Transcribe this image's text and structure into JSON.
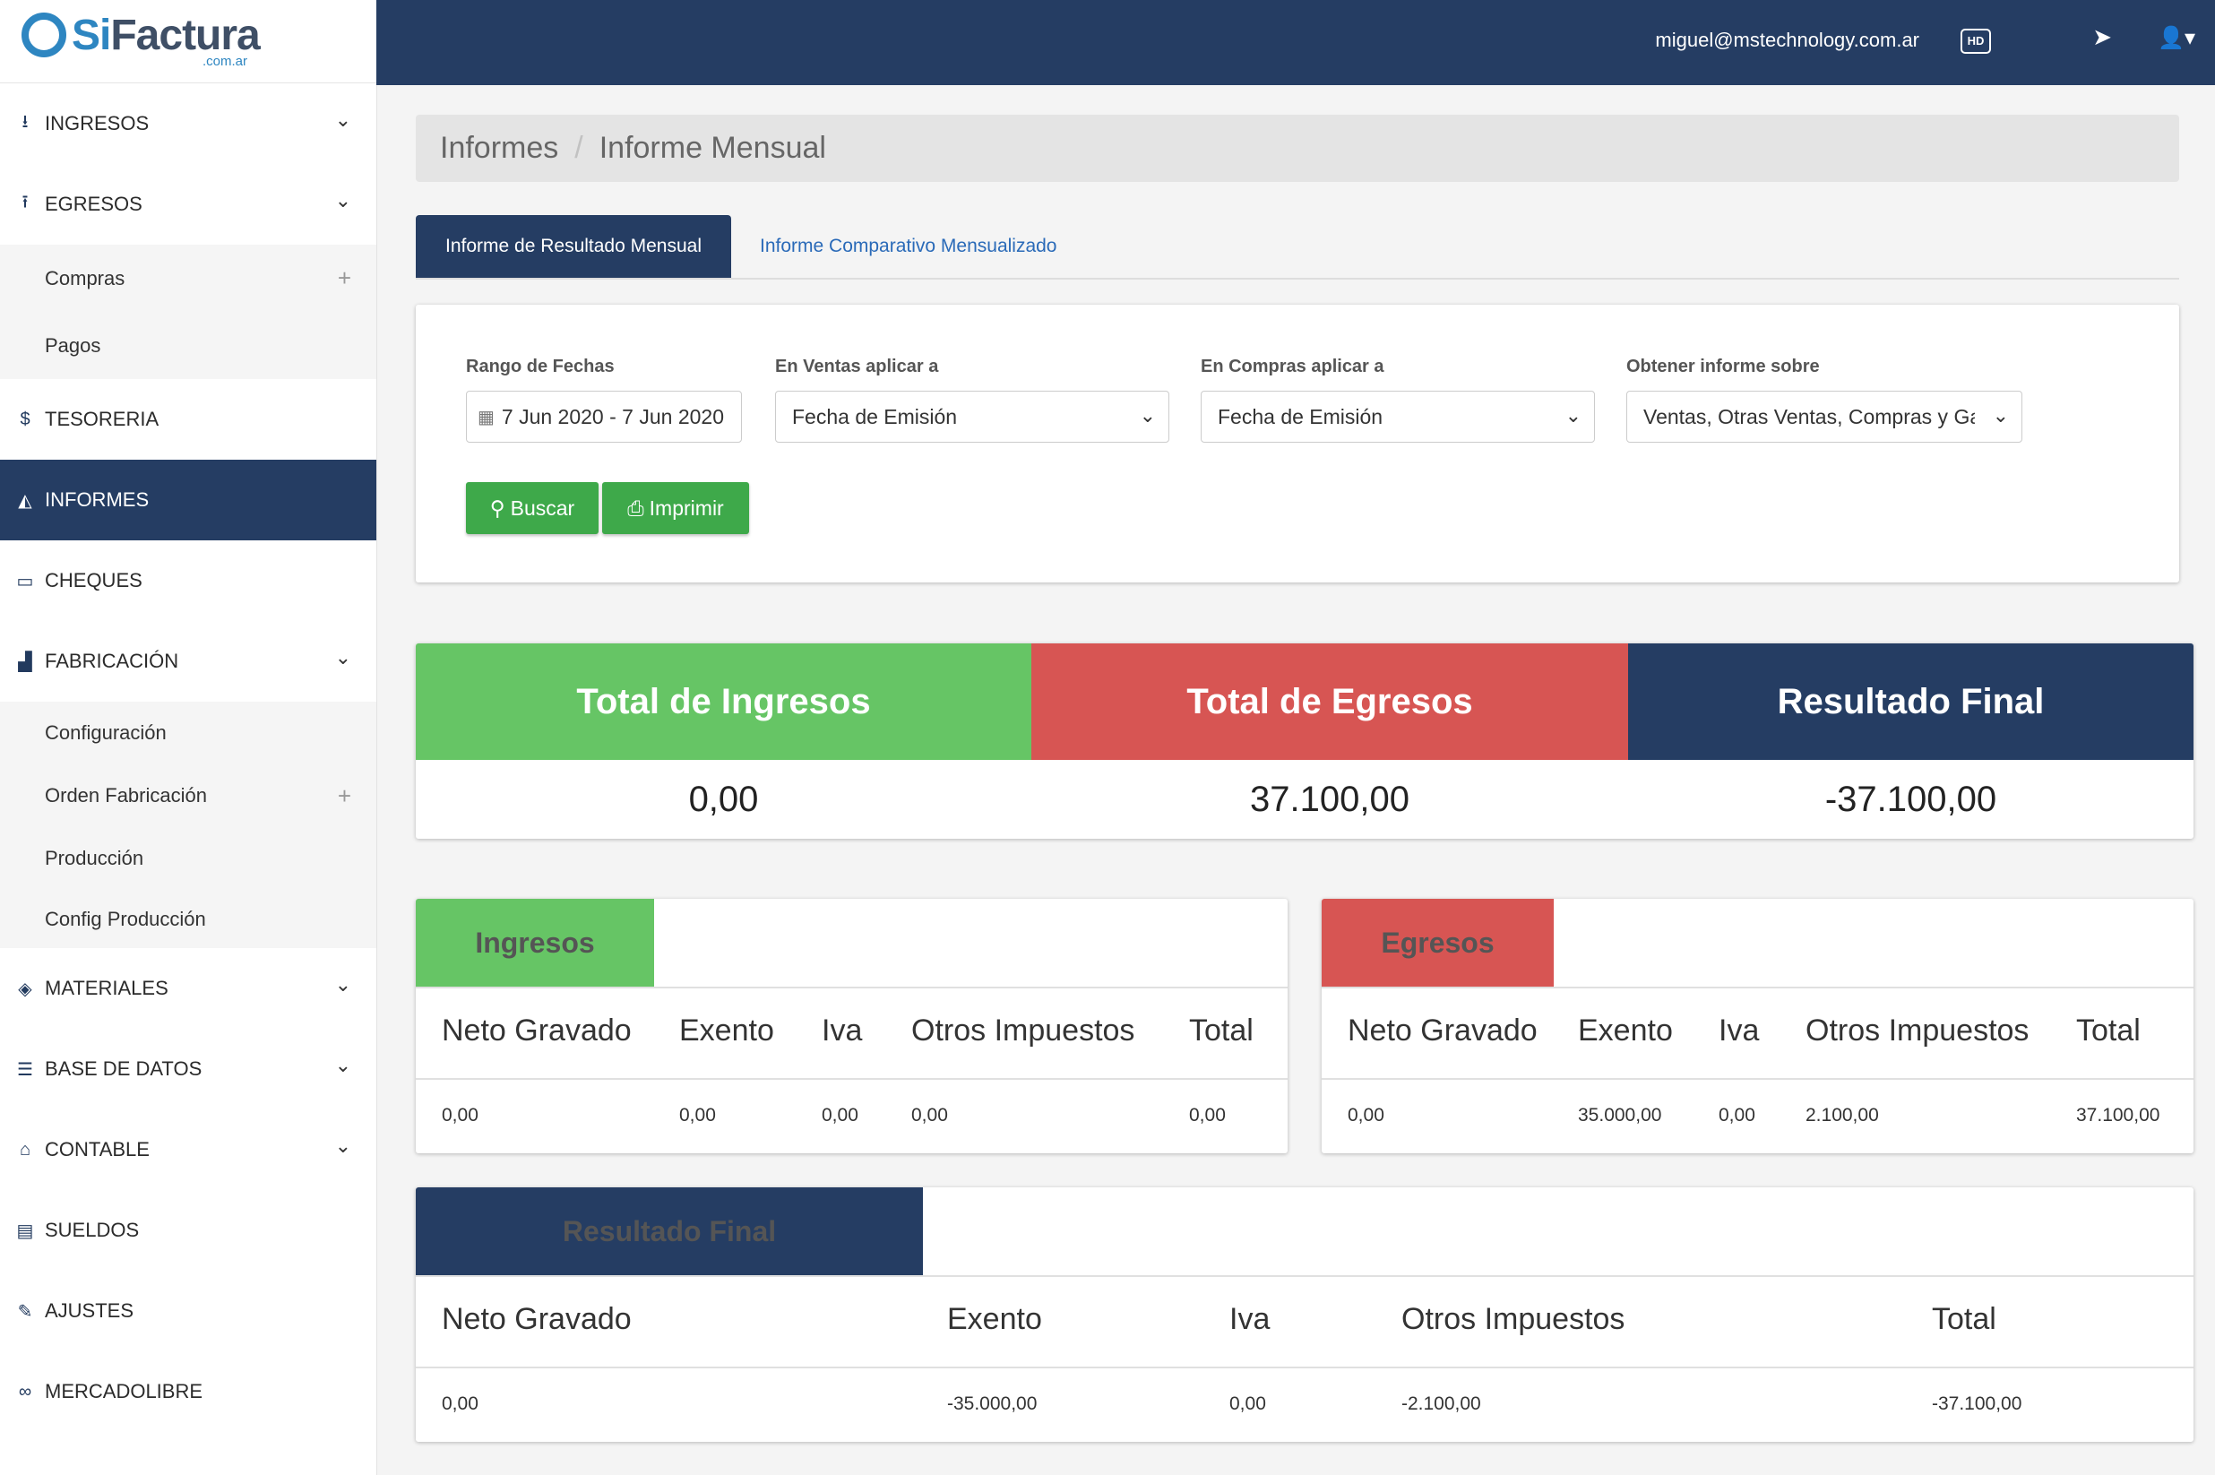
{
  "brand": {
    "name_si": "Si",
    "name_rest": "Factura",
    "tld": ".com.ar"
  },
  "sidebar": {
    "items": [
      {
        "label": "INGRESOS",
        "icon": "download-icon"
      },
      {
        "label": "EGRESOS",
        "icon": "upload-icon"
      },
      {
        "label": "TESORERIA",
        "icon": "dollar-icon"
      },
      {
        "label": "INFORMES",
        "icon": "area-chart-icon"
      },
      {
        "label": "CHEQUES",
        "icon": "credit-card-icon"
      },
      {
        "label": "FABRICACIÓN",
        "icon": "industry-icon"
      },
      {
        "label": "MATERIALES",
        "icon": "cubes-icon"
      },
      {
        "label": "BASE DE DATOS",
        "icon": "database-icon"
      },
      {
        "label": "CONTABLE",
        "icon": "bank-icon"
      },
      {
        "label": "SUELDOS",
        "icon": "book-icon"
      },
      {
        "label": "AJUSTES",
        "icon": "wrench-icon"
      },
      {
        "label": "MERCADOLIBRE",
        "icon": "handshake-icon"
      }
    ],
    "egresos_sub": [
      "Compras",
      "Pagos"
    ],
    "fabricacion_sub": [
      "Configuración",
      "Orden Fabricación",
      "Producción",
      "Config Producción"
    ]
  },
  "topbar": {
    "email": "miguel@mstechnology.com.ar",
    "hd_label": "HD"
  },
  "breadcrumb": {
    "parent": "Informes",
    "separator": "/",
    "current": "Informe Mensual"
  },
  "tabs": {
    "active": "Informe de Resultado Mensual",
    "other": "Informe Comparativo Mensualizado"
  },
  "filters": {
    "range_label": "Rango de Fechas",
    "range_value": "7 Jun 2020 - 7 Jun 2020",
    "ventas_label": "En Ventas aplicar a",
    "ventas_value": "Fecha de Emisión",
    "compras_label": "En Compras aplicar a",
    "compras_value": "Fecha de Emisión",
    "informe_label": "Obtener informe sobre",
    "informe_value": "Ventas, Otras Ventas, Compras y Gas",
    "buscar": "Buscar",
    "imprimir": "Imprimir"
  },
  "colors": {
    "navy": "#253d63",
    "green": "#66c565",
    "red": "#d75553",
    "button_green": "#3ea94a"
  },
  "totals": {
    "ingresos_label": "Total de Ingresos",
    "ingresos_value": "0,00",
    "egresos_label": "Total de Egresos",
    "egresos_value": "37.100,00",
    "resultado_label": "Resultado Final",
    "resultado_value": "-37.100,00"
  },
  "columns": [
    "Neto Gravado",
    "Exento",
    "Iva",
    "Otros Impuestos",
    "Total"
  ],
  "ingresos": {
    "title": "Ingresos",
    "row": [
      "0,00",
      "0,00",
      "0,00",
      "0,00",
      "0,00"
    ]
  },
  "egresos": {
    "title": "Egresos",
    "row": [
      "0,00",
      "35.000,00",
      "0,00",
      "2.100,00",
      "37.100,00"
    ]
  },
  "resultado": {
    "title": "Resultado Final",
    "row": [
      "0,00",
      "-35.000,00",
      "0,00",
      "-2.100,00",
      "-37.100,00"
    ]
  }
}
